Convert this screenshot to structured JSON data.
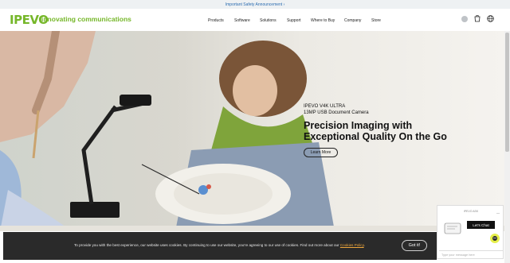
{
  "announcement": {
    "text": "Important Safety Announcement"
  },
  "header": {
    "logo": "IPEVO",
    "tagline": "innovating communications",
    "nav": [
      "Products",
      "Software",
      "Solutions",
      "Support",
      "Where to Buy",
      "Company",
      "Store"
    ],
    "icons": [
      "user-icon",
      "cart-icon",
      "globe-icon"
    ]
  },
  "hero": {
    "product_line1": "IPEVO V4K ULTRA",
    "product_line2": "13MP USB Document Camera",
    "headline_line1": "Precision Imaging with",
    "headline_line2": "Exceptional Quality On the Go",
    "cta": "Learn More"
  },
  "cookie": {
    "text_before": "To provide you with the best experience, our website uses cookies. By continuing to use our website, you're agreeing to our use of cookies. Find out more about our ",
    "link": "Cookies Policy",
    "text_after": ".",
    "ok": "Got it!"
  },
  "chat": {
    "header": "IPEVO ASK",
    "bubble": "Let's Chat",
    "input_placeholder": "Type your message here"
  },
  "colors": {
    "brand": "#76b72a",
    "link": "#2b6cb0",
    "cookie_bg": "#2a2a2a",
    "cookie_link": "#f0a83c"
  }
}
